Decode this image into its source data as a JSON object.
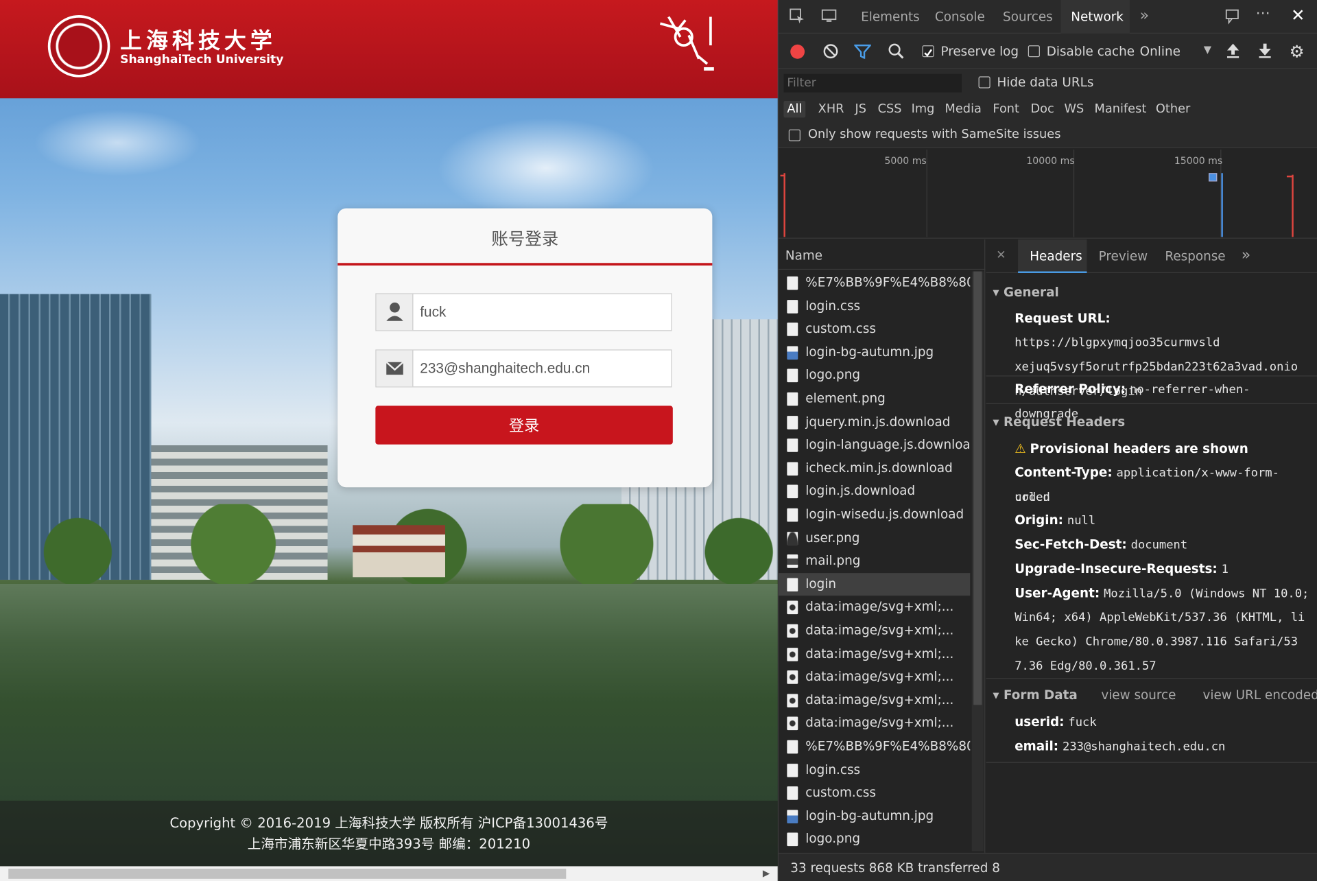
{
  "page": {
    "logo_cn": "上海科技大学",
    "logo_en": "ShanghaiTech University",
    "login": {
      "title": "账号登录",
      "userid_value": "fuck",
      "email_value": "233@shanghaitech.edu.cn",
      "submit_label": "登录"
    },
    "footer": {
      "line1": "Copyright © 2016-2019 上海科技大学 版权所有   沪ICP备13001436号",
      "line2": "上海市浦东新区华夏中路393号 邮编：201210"
    }
  },
  "devtools": {
    "tabs": [
      "Elements",
      "Console",
      "Sources",
      "Network"
    ],
    "active_tab": "Network",
    "more_tabs": "»",
    "toolbar": {
      "preserve_log": "Preserve log",
      "disable_cache": "Disable cache",
      "throttle": "Online",
      "preserve_checked": true,
      "disable_checked": false
    },
    "filter": {
      "placeholder": "Filter",
      "hide_data_urls": "Hide data URLs",
      "types": [
        "All",
        "XHR",
        "JS",
        "CSS",
        "Img",
        "Media",
        "Font",
        "Doc",
        "WS",
        "Manifest",
        "Other"
      ],
      "samesite": "Only show requests with SameSite issues"
    },
    "timeline_ticks": [
      "5000 ms",
      "10000 ms",
      "15000 ms"
    ],
    "name_header": "Name",
    "requests": [
      {
        "name": "%E7%BB%9F%E4%B8%80%...",
        "icon": "doc"
      },
      {
        "name": "login.css",
        "icon": "doc"
      },
      {
        "name": "custom.css",
        "icon": "doc"
      },
      {
        "name": "login-bg-autumn.jpg",
        "icon": "img"
      },
      {
        "name": "logo.png",
        "icon": "doc"
      },
      {
        "name": "element.png",
        "icon": "doc"
      },
      {
        "name": "jquery.min.js.download",
        "icon": "doc"
      },
      {
        "name": "login-language.js.download",
        "icon": "doc"
      },
      {
        "name": "icheck.min.js.download",
        "icon": "doc"
      },
      {
        "name": "login.js.download",
        "icon": "doc"
      },
      {
        "name": "login-wisedu.js.download",
        "icon": "doc"
      },
      {
        "name": "user.png",
        "icon": "user"
      },
      {
        "name": "mail.png",
        "icon": "mail"
      },
      {
        "name": "login",
        "icon": "doc",
        "selected": true
      },
      {
        "name": "data:image/svg+xml;...",
        "icon": "svg"
      },
      {
        "name": "data:image/svg+xml;...",
        "icon": "svg"
      },
      {
        "name": "data:image/svg+xml;...",
        "icon": "svg"
      },
      {
        "name": "data:image/svg+xml;...",
        "icon": "svg"
      },
      {
        "name": "data:image/svg+xml;...",
        "icon": "svg"
      },
      {
        "name": "data:image/svg+xml;...",
        "icon": "svg"
      },
      {
        "name": "%E7%BB%9F%E4%B8%80%...",
        "icon": "doc"
      },
      {
        "name": "login.css",
        "icon": "doc"
      },
      {
        "name": "custom.css",
        "icon": "doc"
      },
      {
        "name": "login-bg-autumn.jpg",
        "icon": "img"
      },
      {
        "name": "logo.png",
        "icon": "doc"
      }
    ],
    "detail": {
      "tabs": [
        "Headers",
        "Preview",
        "Response"
      ],
      "active_tab": "Headers",
      "general_title": "General",
      "request_url_key": "Request URL:",
      "request_url_lines": [
        "https://blgpxymqjoo35curmvsld",
        "xejuq5vsyf5orutrfp25bdan223t62a3vad.onio",
        "n/authserver/login"
      ],
      "referrer_key": "Referrer Policy:",
      "referrer_val": "no-referrer-when-downgrade",
      "req_headers_title": "Request Headers",
      "provisional": "Provisional headers are shown",
      "headers": [
        {
          "k": "Content-Type:",
          "v": "application/x-www-form-urlen"
        },
        {
          "k": "",
          "v": "coded"
        },
        {
          "k": "Origin:",
          "v": "null"
        },
        {
          "k": "Sec-Fetch-Dest:",
          "v": "document"
        },
        {
          "k": "Upgrade-Insecure-Requests:",
          "v": "1"
        },
        {
          "k": "User-Agent:",
          "v": "Mozilla/5.0 (Windows NT 10.0;"
        },
        {
          "k": "",
          "v": "Win64; x64) AppleWebKit/537.36 (KHTML, li"
        },
        {
          "k": "",
          "v": "ke Gecko) Chrome/80.0.3987.116 Safari/53"
        },
        {
          "k": "",
          "v": "7.36 Edg/80.0.361.57"
        }
      ],
      "form_title": "Form Data",
      "view_source": "view source",
      "view_url_encoded": "view URL encoded",
      "form": [
        {
          "k": "userid:",
          "v": "fuck"
        },
        {
          "k": "email:",
          "v": "233@shanghaitech.edu.cn"
        }
      ]
    },
    "status": "33 requests   868 KB transferred   8"
  }
}
